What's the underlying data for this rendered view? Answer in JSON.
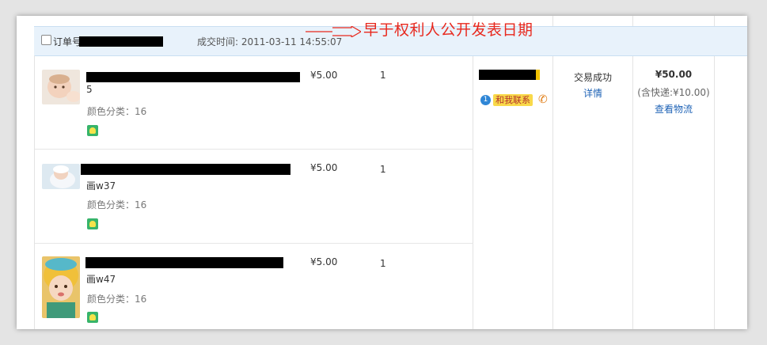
{
  "header": {
    "order_label": "订单号",
    "deal_time": "成交时间: 2011-03-11 14:55:07",
    "note": "早于权利人公开发表日期"
  },
  "items": [
    {
      "title_line2": "5",
      "color_category": "颜色分类：16",
      "price": "¥5.00",
      "quantity": "1"
    },
    {
      "title_line2": "画w37",
      "color_category": "颜色分类：16",
      "price": "¥5.00",
      "quantity": "1"
    },
    {
      "title_line2": "画w47",
      "color_category": "颜色分类：16",
      "price": "¥5.00",
      "quantity": "1"
    }
  ],
  "seller": {
    "contact_label": "和我联系"
  },
  "status": {
    "text": "交易成功",
    "detail_link": "详情"
  },
  "total": {
    "amount": "¥50.00",
    "shipping": "(含快递:¥10.00)",
    "logistics_link": "查看物流"
  },
  "colors": {
    "header_bg": "#e8f2fb",
    "note_red": "#e8281d",
    "link_blue": "#1f63b6"
  }
}
